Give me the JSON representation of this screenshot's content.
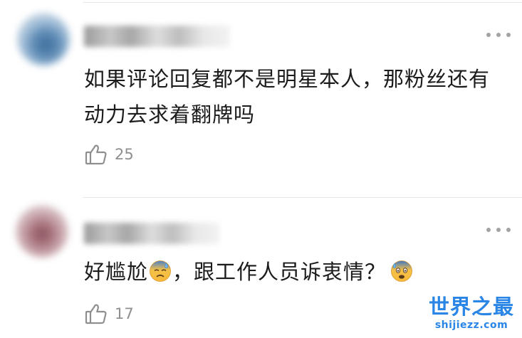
{
  "comments": [
    {
      "text": "如果评论回复都不是明星本人，那粉丝还有\n动力去求着翻牌吗",
      "likes": "25"
    },
    {
      "text_before_emoji": "好尴尬",
      "emoji_1": "sad-sweat-emoji",
      "text_middle": "，跟工作人员诉衷情？",
      "emoji_2": "anxious-sweat-emoji",
      "likes": "17"
    }
  ],
  "watermark": {
    "title": "世界之最",
    "url": "shijiezz.com"
  },
  "colors": {
    "text": "#1b1b1b",
    "meta": "#8f8f8f",
    "divider": "#e7e7e7",
    "watermark": "#2a86e6",
    "emoji": "#f8b93a"
  },
  "icons": {
    "like": "thumbs-up-icon",
    "more": "more-options-icon"
  }
}
